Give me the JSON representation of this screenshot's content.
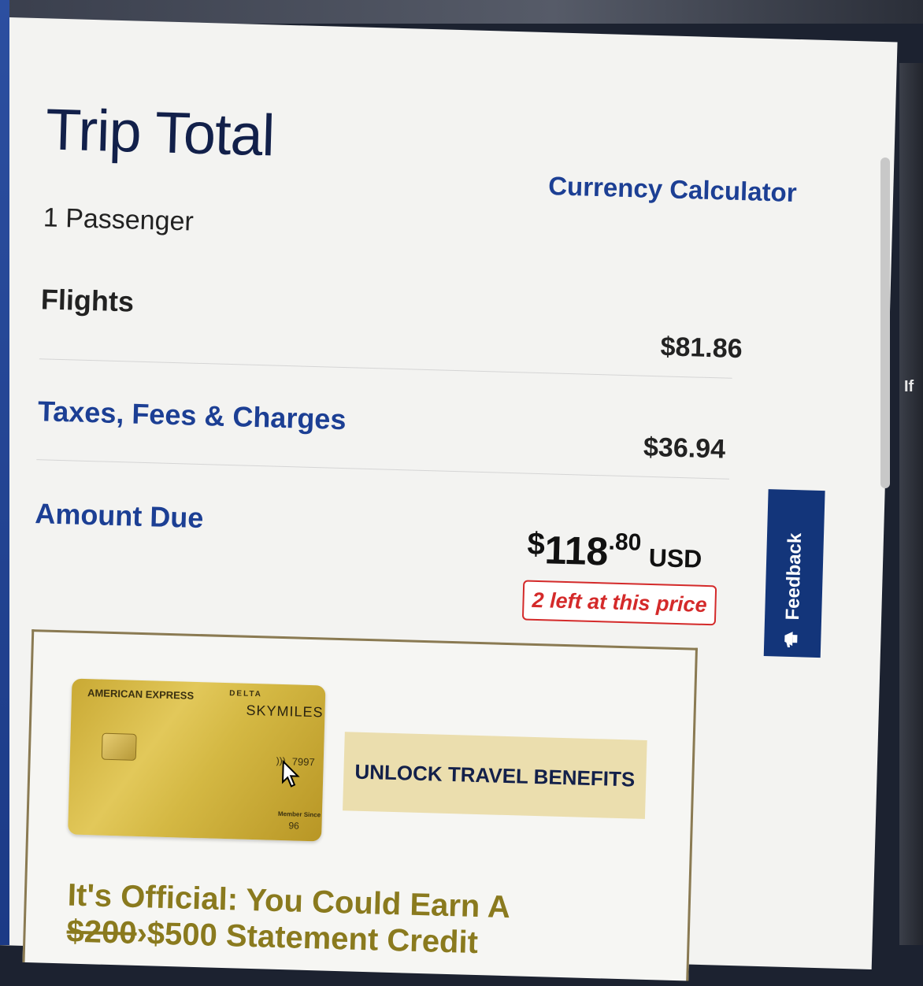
{
  "trip_total": {
    "title": "Trip Total",
    "currency_link": "Currency Calculator",
    "passengers": "1 Passenger",
    "rows": [
      {
        "label": "Flights",
        "value": "$81.86"
      },
      {
        "label": "Taxes, Fees & Charges",
        "value": "$36.94"
      }
    ],
    "amount_due": {
      "label": "Amount Due",
      "symbol": "$",
      "whole": "118",
      "decimal": ".80",
      "currency": "USD",
      "availability": "2 left at this price"
    }
  },
  "promo": {
    "card": {
      "brand": "AMERICAN EXPRESS",
      "logo": "DELTA",
      "program": "SKYMILES",
      "contactless": ")))",
      "number": "7997",
      "member_since_label": "Member Since",
      "member_since": "96"
    },
    "button": "UNLOCK TRAVEL BENEFITS",
    "headline_line1": "It's Official: You Could Earn A",
    "headline_old": "$200",
    "headline_new": "$500 Statement Credit"
  },
  "feedback": {
    "label": "Feedback",
    "icon": "megaphone-icon"
  },
  "side_text": "If",
  "colors": {
    "navy": "#13204a",
    "link_blue": "#1c3f94",
    "alert_red": "#d42a2a",
    "feedback_bg": "#13357a",
    "promo_gold": "#8a7a1e"
  }
}
